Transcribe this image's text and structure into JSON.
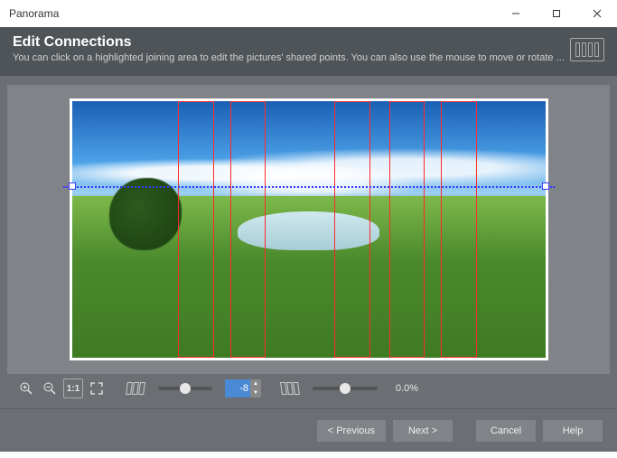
{
  "window": {
    "title": "Panorama"
  },
  "header": {
    "title": "Edit Connections",
    "subtitle": "You can click on a highlighted joining area to edit the pictures' shared points. You can also use the mouse to move or rotate ..."
  },
  "overlay": {
    "redbox_positions_pct": [
      22.5,
      33.5,
      55.5,
      67.0,
      78.0
    ],
    "redbox_width_pct": 7.5,
    "hline_top_pct": 33,
    "handle_left_pct": 0,
    "handle_right_pct": 100
  },
  "toolbar": {
    "zoom_in_icon": "zoom-in",
    "zoom_out_icon": "zoom-out",
    "one_to_one_label": "1:1",
    "fit_icon": "fit",
    "angle_value": "-8",
    "percent_label": "0.0%",
    "slider1_pos_pct": 50,
    "slider2_pos_pct": 50
  },
  "footer": {
    "previous": "< Previous",
    "next": "Next >",
    "cancel": "Cancel",
    "help": "Help"
  }
}
